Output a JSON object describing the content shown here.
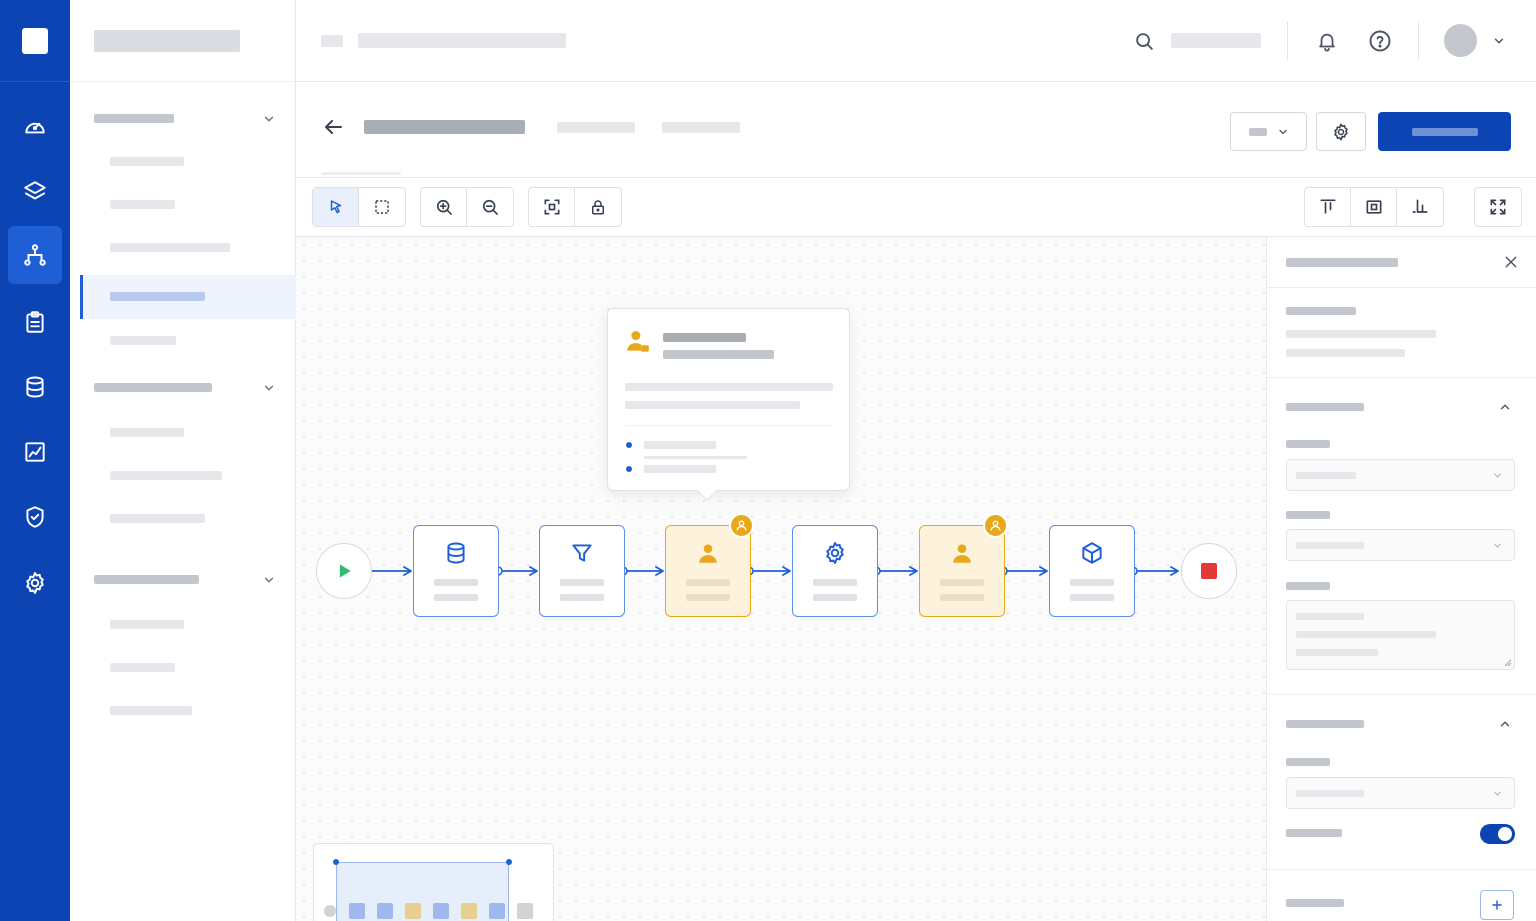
{
  "app": {
    "accent_color": "#0c45b3",
    "human_task_color": "#e8a81c"
  },
  "rail": {
    "items": [
      {
        "icon": "gauge-icon"
      },
      {
        "icon": "layers-icon"
      },
      {
        "icon": "workflow-icon",
        "active": true
      },
      {
        "icon": "clipboard-icon"
      },
      {
        "icon": "database-icon"
      },
      {
        "icon": "chart-icon"
      },
      {
        "icon": "shield-check-icon"
      },
      {
        "icon": "gear-icon"
      }
    ]
  },
  "header": {
    "icons": [
      "search-icon",
      "bell-icon",
      "help-icon",
      "avatar",
      "chevron-down-icon"
    ]
  },
  "page": {
    "actions": [
      "dropdown-button",
      "settings-button",
      "primary-action-button"
    ]
  },
  "toolbar": {
    "left_tools": [
      "pointer-icon",
      "marquee-select-icon",
      "zoom-in-icon",
      "zoom-out-icon",
      "fit-view-icon",
      "lock-icon"
    ],
    "right_tools": [
      "align-top-icon",
      "center-icon",
      "align-bottom-icon",
      "fullscreen-icon"
    ]
  },
  "flow": {
    "nodes": [
      {
        "type": "start",
        "icon": "play-icon"
      },
      {
        "type": "task",
        "icon": "database-icon"
      },
      {
        "type": "task",
        "icon": "filter-icon"
      },
      {
        "type": "human",
        "icon": "user-icon"
      },
      {
        "type": "task",
        "icon": "gear-icon"
      },
      {
        "type": "human",
        "icon": "user-icon"
      },
      {
        "type": "task",
        "icon": "box-icon"
      },
      {
        "type": "end",
        "icon": "stop-icon"
      }
    ]
  }
}
